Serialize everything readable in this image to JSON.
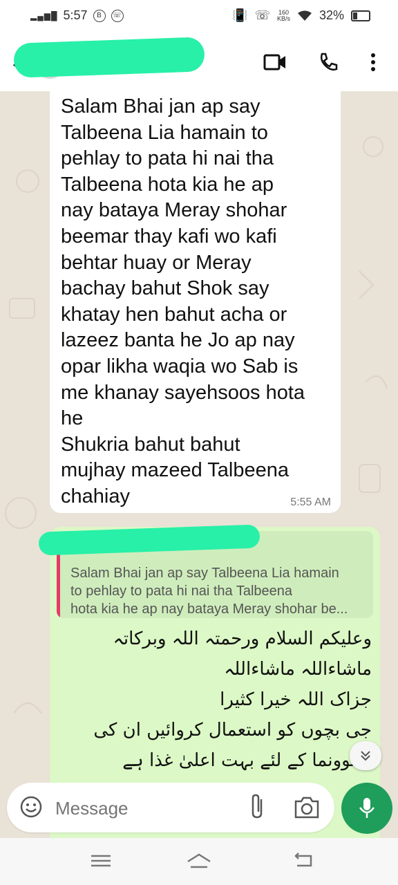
{
  "status_bar": {
    "time": "5:57",
    "network_speed_value": "160",
    "network_speed_unit": "KB/s",
    "battery": "32%",
    "battery_level": 0.32
  },
  "header": {
    "back_icon": "arrow-left-icon",
    "video_icon": "video-call-icon",
    "call_icon": "phone-icon",
    "menu_icon": "more-vertical-icon"
  },
  "messages": {
    "incoming": {
      "text": "Salam Bhai jan ap say\nTalbeena Lia hamain to\npehlay to pata hi nai tha\nTalbeena hota kia he ap\nnay bataya Meray shohar\nbeemar thay kafi wo kafi\nbehtar huay or Meray\nbachay bahut Shok say\nkhatay hen bahut acha or\nlazeez banta he Jo ap nay\nopar likha waqia wo Sab is\nme khanay sayehsoos hota\nhe\nShukria bahut bahut\nmujhay mazeed Talbeena\nchahiay",
      "time": "5:55 AM"
    },
    "outgoing": {
      "quoted_text": "Salam Bhai jan ap say Talbeena Lia hamain\nto pehlay to pata hi nai tha Talbeena\nhota kia he ap nay bataya Meray shohar be...",
      "urdu_text": "وعلیکم السلام ورحمتہ اللہ وبرکاتہ\nماشاءاللہ ماشاءاللہ\nجزاک اللہ خیرا کثیرا\nجی بچوں کو استعمال کروائیں ان کی\nنشوونما کے لئے بہت اعلیٰ غذا ہے"
    }
  },
  "composer": {
    "placeholder": "Message",
    "emoji_icon": "emoji-icon",
    "attach_icon": "paperclip-icon",
    "camera_icon": "camera-icon",
    "mic_icon": "microphone-icon"
  },
  "nav_bar": {
    "menu_icon": "menu-icon",
    "home_icon": "home-icon",
    "back_icon": "back-icon"
  },
  "colors": {
    "accent": "#1f9d5a",
    "outgoing_bubble": "#dcf8c6",
    "quote_accent": "#e83a6a",
    "redaction": "#28f0a8"
  }
}
